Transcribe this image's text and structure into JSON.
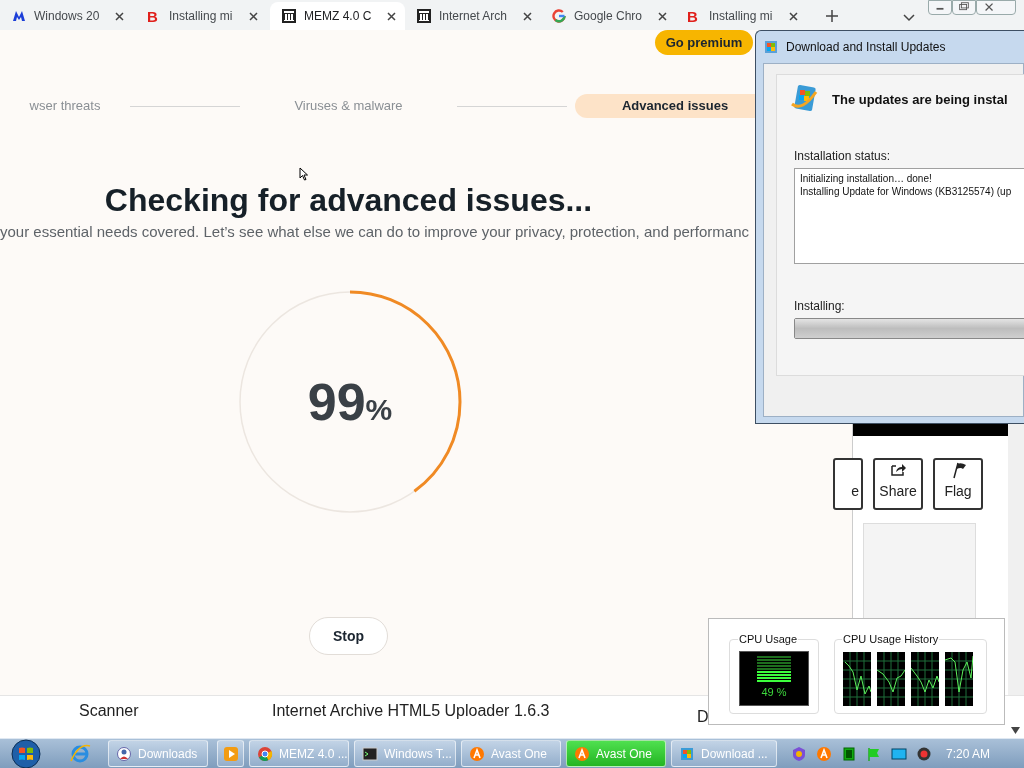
{
  "browser": {
    "tabs": [
      {
        "label": "Windows 20",
        "selected": false
      },
      {
        "label": "Installing mi",
        "icon_text": "B",
        "selected": false
      },
      {
        "label": "MEMZ 4.0 C",
        "selected": true
      },
      {
        "label": "Internet Arch",
        "selected": false
      },
      {
        "label": "Google Chro",
        "selected": false
      },
      {
        "label": "Installing mi",
        "icon_text": "B",
        "selected": false
      }
    ]
  },
  "avast": {
    "premium_button": "Go premium",
    "steps": [
      {
        "label": "wser threats",
        "selected": false
      },
      {
        "label": "Viruses & malware",
        "selected": false
      },
      {
        "label": "Advanced issues",
        "selected": true
      }
    ],
    "title": "Checking for advanced issues...",
    "subtitle": "your essential needs covered. Let’s see what else we can do to improve your privacy, protection, and performanc",
    "progress": {
      "value": "99",
      "unit": "%",
      "level": 0.4
    },
    "stop_button": "Stop"
  },
  "archive_page": {
    "column_1": "Scanner",
    "column_2": "Internet Archive HTML5 Uploader 1.6.3",
    "column_3": "D",
    "buttons": [
      {
        "label": "e",
        "kind": "cut"
      },
      {
        "label": "Share",
        "kind": "share"
      },
      {
        "label": "Flag",
        "kind": "flag"
      }
    ]
  },
  "update_window": {
    "title": "Download and Install Updates",
    "heading": "The updates are being instal",
    "status_label": "Installation status:",
    "log": [
      "Initializing installation… done!",
      "Installing Update for Windows (KB3125574) (up"
    ],
    "progress_label": "Installing:",
    "level": 1
  },
  "cpu_gadget": {
    "usage_label": "CPU Usage",
    "usage_reading": "49 %",
    "level": 0.49,
    "history_label": "CPU Usage History"
  },
  "taskbar": {
    "items": [
      {
        "label": "Downloads",
        "selected": false
      },
      {
        "label": "MEMZ 4.0 ...",
        "selected": false
      },
      {
        "label": "Windows T...",
        "selected": false
      },
      {
        "label": "Avast One",
        "selected": false
      },
      {
        "label": "Avast One",
        "selected": true
      },
      {
        "label": "Download ...",
        "selected": false
      }
    ],
    "clock": "7:20 AM"
  }
}
